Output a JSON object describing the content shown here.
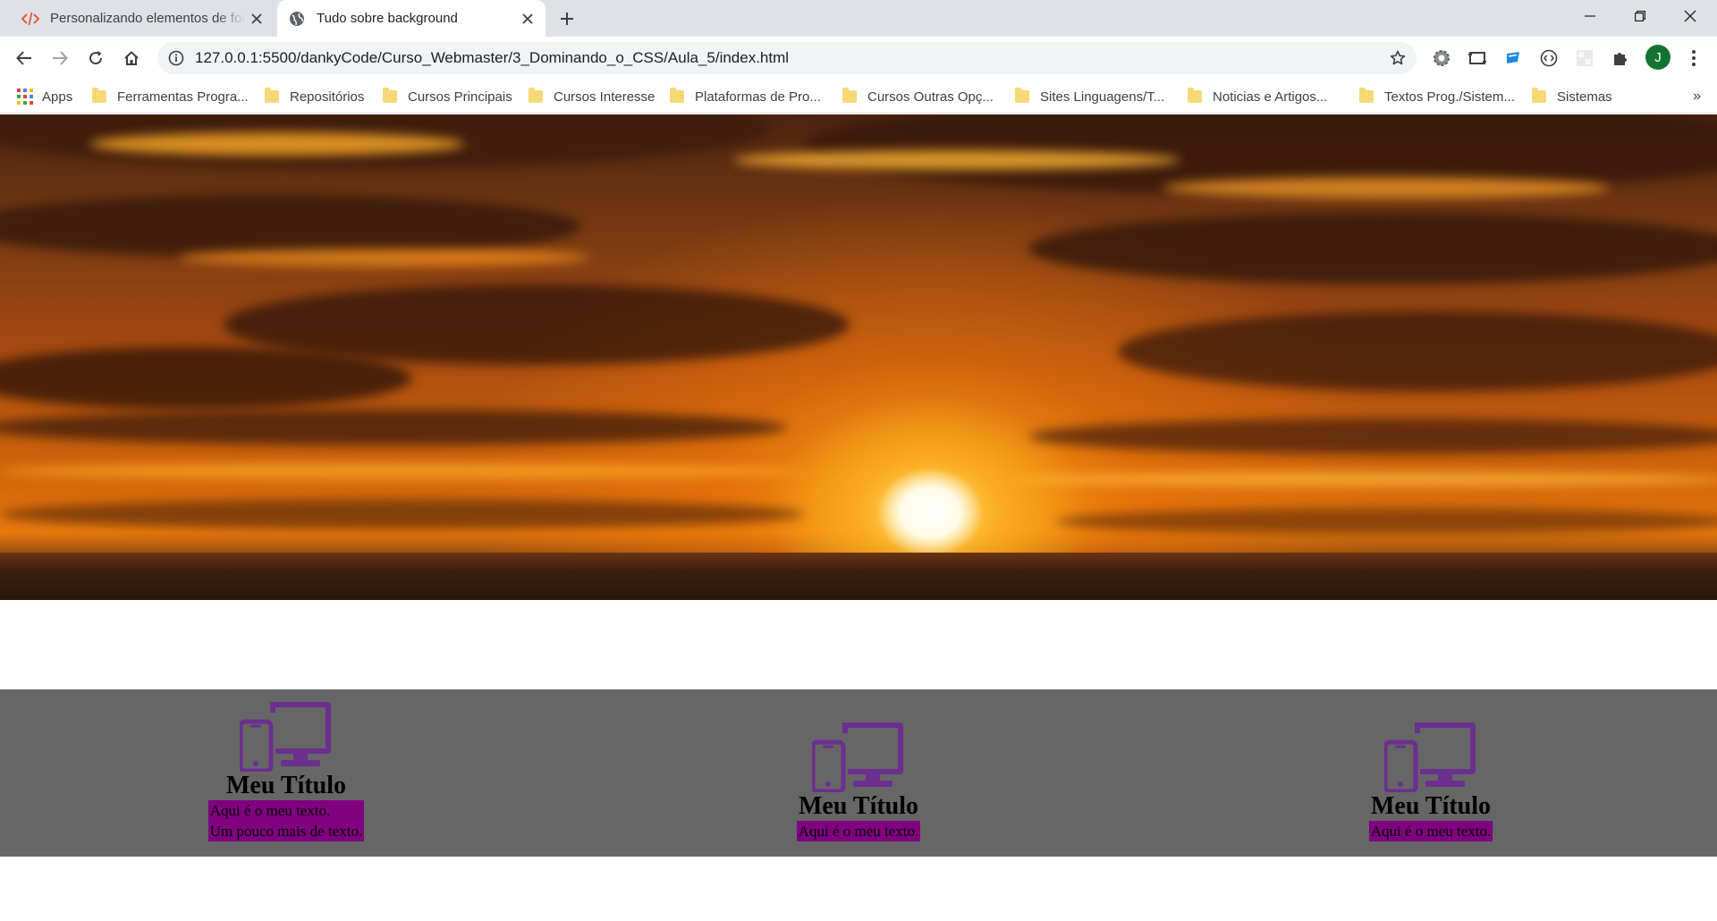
{
  "browser": {
    "tabs": [
      {
        "title": "Personalizando elementos de formulário",
        "active": false,
        "icon": "code-icon"
      },
      {
        "title": "Tudo sobre background",
        "active": true,
        "icon": "globe-icon"
      }
    ],
    "url": "127.0.0.1:5500/dankyCode/Curso_Webmaster/3_Dominando_o_CSS/Aula_5/index.html",
    "avatar_letter": "J",
    "bookmarks": {
      "apps_label": "Apps",
      "items": [
        "Ferramentas Progra...",
        "Repositórios",
        "Cursos Principais",
        "Cursos Interesse",
        "Plataformas de Pro...",
        "Cursos Outras Opç...",
        "Sites Linguagens/T...",
        "Noticias e Artigos...",
        "Textos Prog./Sistem...",
        "Sistemas"
      ],
      "more": "»"
    }
  },
  "page": {
    "hero_image": "sunset-clouds",
    "section_bg": "#666666",
    "text_bg": "#800080",
    "icon_color": "#6b2f8f",
    "cards": [
      {
        "title": "Meu Título",
        "lines": [
          "Aqui é o meu texto.",
          "Um pouco mais de texto."
        ],
        "icon": "devices-icon"
      },
      {
        "title": "Meu Título",
        "lines": [
          "Aqui é o meu texto."
        ],
        "icon": "devices-icon"
      },
      {
        "title": "Meu Título",
        "lines": [
          "Aqui é o meu texto."
        ],
        "icon": "devices-icon"
      }
    ]
  }
}
